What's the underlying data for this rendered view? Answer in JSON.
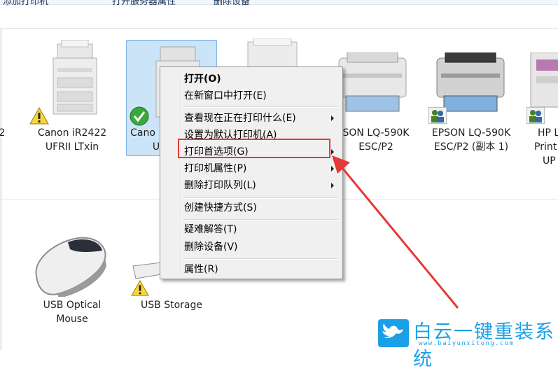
{
  "toolbar": {
    "item1": "添加打印机",
    "item2": "打开服务器属性",
    "item3": "删除设备"
  },
  "devices": [
    {
      "label1": "2",
      "label2": ""
    },
    {
      "label1": "Canon iR2422",
      "label2": "UFRII LTxin"
    },
    {
      "label1": "Cano",
      "label2": "U"
    },
    {
      "label1": "SON LQ-590K",
      "label2": "ESC/P2"
    },
    {
      "label1": "EPSON LQ-590K",
      "label2": "ESC/P2 (副本 1)"
    },
    {
      "label1": "HP L",
      "label2": "Print"
    },
    {
      "label3": "UP"
    }
  ],
  "devices_bottom": [
    {
      "label1": "USB Optical",
      "label2": "Mouse"
    },
    {
      "label1": "USB Storage"
    }
  ],
  "context_menu": {
    "open": "打开(O)",
    "open_new_window": "在新窗口中打开(E)",
    "see_printing": "查看现在正在打印什么(E)",
    "set_default": "设置为默认打印机(A)",
    "print_preferences": "打印首选项(G)",
    "printer_properties": "打印机属性(P)",
    "remove_queue": "删除打印队列(L)",
    "create_shortcut": "创建快捷方式(S)",
    "troubleshoot": "疑难解答(T)",
    "remove_device": "删除设备(V)",
    "properties": "属性(R)"
  },
  "watermark": {
    "title": "白云一键重装系统",
    "url": "www.baiyunxitong.com"
  },
  "colors": {
    "highlight_box": "#e53935",
    "arrow": "#e53935",
    "selection": "#cce4f7",
    "watermark": "#1aa0e6"
  }
}
